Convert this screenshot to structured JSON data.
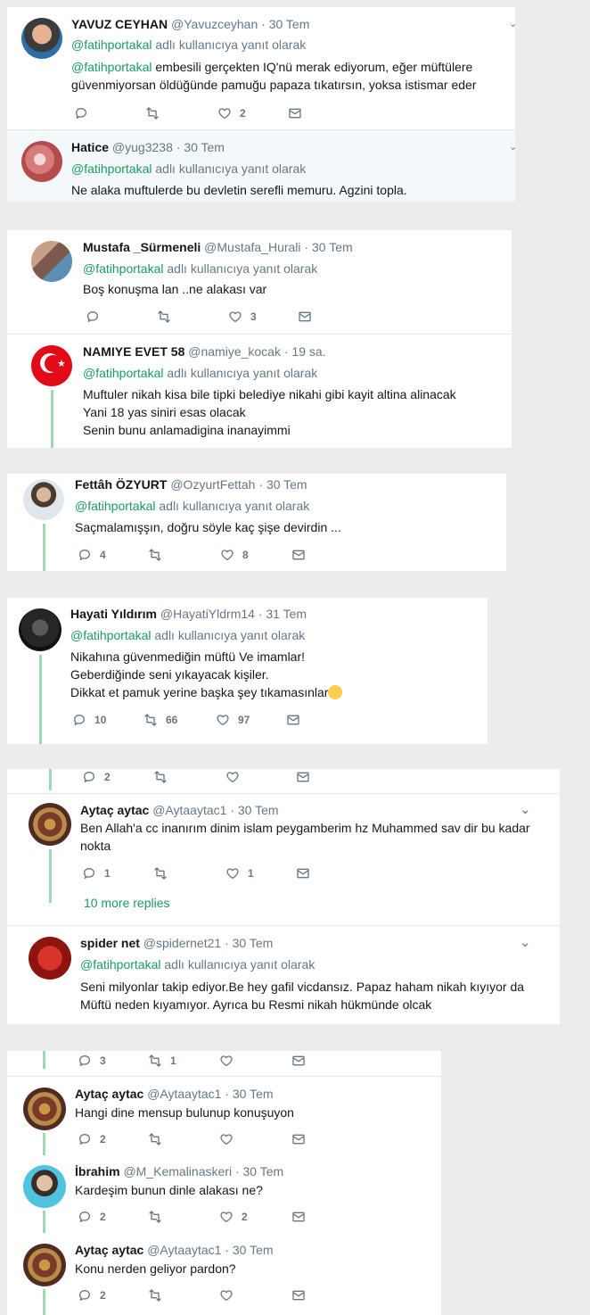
{
  "reply_label": "adlı kullanıcıya yanıt olarak",
  "reply_mention": "@fatihportakal",
  "colors": {
    "accent": "#1a9b5f",
    "muted": "#657786",
    "thread_line": "#9fd8b5",
    "card": "#ffffff",
    "highlight": "#f5f8fa"
  },
  "tweets": [
    {
      "name": "YAVUZ CEYHAN",
      "handle": "@Yavuzceyhan",
      "time": "30 Tem",
      "mention": "@fatihportakal",
      "lines": [
        "embesili gerçekten IQ'nü merak ediyorum, eğer müftülere",
        "güvenmiyorsan öldüğünde pamuğu papaza tıkatırsın, yoksa istismar eder"
      ],
      "reply_count": "",
      "retweet_count": "",
      "like_count": "2"
    },
    {
      "name": "Hatice",
      "handle": "@yug3238",
      "time": "30 Tem",
      "lines": [
        "Ne alaka muftulerde bu devletin serefli memuru. Agzini topla."
      ]
    },
    {
      "name": "Mustafa _Sürmeneli",
      "handle": "@Mustafa_Hurali",
      "time": "30 Tem",
      "lines": [
        "Boş konuşma lan ..ne alakası var"
      ],
      "reply_count": "",
      "retweet_count": "",
      "like_count": "3"
    },
    {
      "name": "NAMIYE EVET 58",
      "handle": "@namiye_kocak",
      "time": "19 sa.",
      "lines": [
        "Muftuler nikah kisa bile tipki belediye nikahi gibi kayit altina alinacak",
        "Yani 18 yas siniri esas olacak",
        "Senin bunu anlamadigina inanayimmi"
      ]
    },
    {
      "name": "Fettâh ÖZYURT",
      "handle": "@OzyurtFettah",
      "time": "30 Tem",
      "lines": [
        "Saçmalamışşın, doğru söyle kaç şişe devirdin ..."
      ],
      "reply_count": "4",
      "retweet_count": "",
      "like_count": "8"
    },
    {
      "name": "Hayati Yıldırım",
      "handle": "@HayatiYldrm14",
      "time": "31 Tem",
      "lines": [
        "Nikahına güvenmediğin müftü Ve imamlar!",
        "Geberdiğinde seni yıkayacak kişiler.",
        "Dikkat et pamuk yerine başka şey tıkamasınlar"
      ],
      "reply_count": "10",
      "retweet_count": "66",
      "like_count": "97"
    },
    {
      "partial_reply_count": "2",
      "name": "Aytaç aytac",
      "handle": "@Aytaaytac1",
      "time": "30 Tem",
      "lines": [
        "Ben Allah'a cc inanırım dinim islam peygamberim hz Muhammed sav dir bu kadar",
        "nokta"
      ],
      "reply_count": "1",
      "retweet_count": "",
      "like_count": "1",
      "more_replies": "10 more replies"
    },
    {
      "name": "spider net",
      "handle": "@spidernet21",
      "time": "30 Tem",
      "lines": [
        "Seni milyonlar takip ediyor.Be hey gafil vicdansız. Papaz haham nikah kıyıyor da",
        "Müftü neden kıyamıyor. Ayrıca bu Resmi nikah hükmünde olcak"
      ]
    },
    {
      "partial_reply_count": "3",
      "partial_retweet_count": "1",
      "name": "Aytaç aytac",
      "handle": "@Aytaaytac1",
      "time": "30 Tem",
      "lines": [
        "Hangi dine mensup bulunup konuşuyon"
      ],
      "reply_count": "2",
      "retweet_count": "",
      "like_count": ""
    },
    {
      "name": "İbrahim",
      "handle": "@M_Kemalinaskeri",
      "time": "30 Tem",
      "lines": [
        "Kardeşim bunun dinle alakası ne?"
      ],
      "reply_count": "2",
      "retweet_count": "",
      "like_count": "2"
    },
    {
      "name": "Aytaç aytac",
      "handle": "@Aytaaytac1",
      "time": "30 Tem",
      "lines": [
        "Konu nerden geliyor pardon?"
      ],
      "reply_count": "2",
      "retweet_count": "",
      "like_count": ""
    }
  ]
}
